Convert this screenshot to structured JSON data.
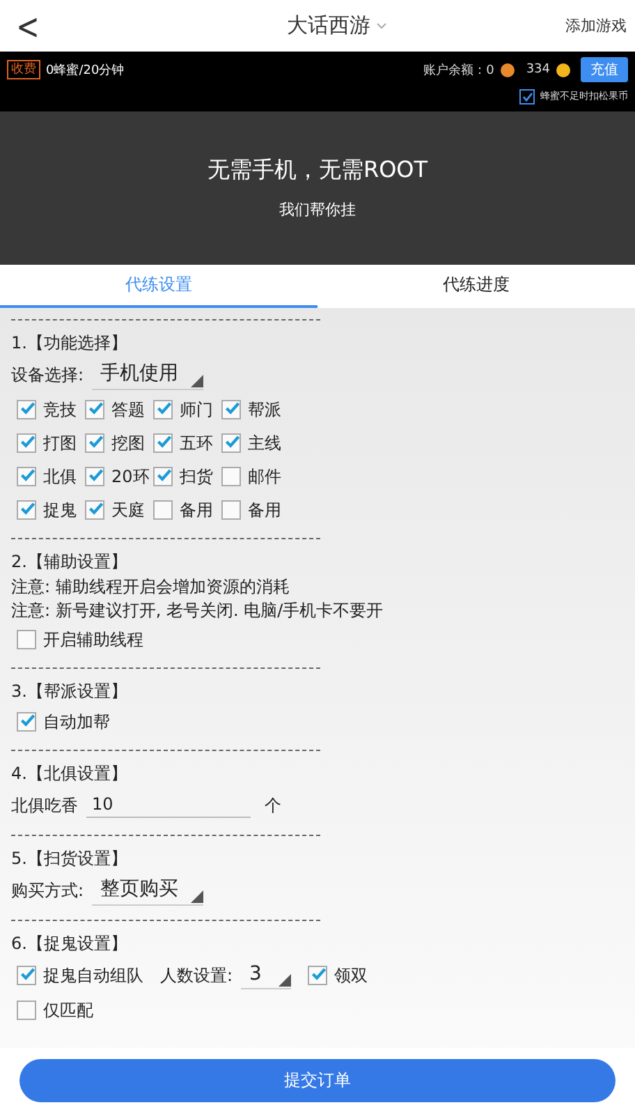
{
  "header": {
    "back": "<",
    "title": "大话西游",
    "action": "添加游戏"
  },
  "account": {
    "badge": "收费",
    "rate": "0蜂蜜/20分钟",
    "balance_label": "账户余额：0",
    "coins": "334",
    "recharge": "充值",
    "auto_deduct": {
      "label": "蜂蜜不足时扣松果币",
      "checked": true
    }
  },
  "banner": {
    "headline": "无需手机，无需ROOT",
    "subline": "我们帮你挂"
  },
  "tabs": [
    {
      "label": "代练设置",
      "selected": true
    },
    {
      "label": "代练进度",
      "selected": false
    }
  ],
  "sections": [
    {
      "title": "1.【功能选择】",
      "items": [
        {
          "kind": "select",
          "label": "设备选择:",
          "value": "手机使用"
        },
        {
          "kind": "grid",
          "options": [
            {
              "label": "竞技",
              "checked": true
            },
            {
              "label": "答题",
              "checked": true
            },
            {
              "label": "师门",
              "checked": true
            },
            {
              "label": "帮派",
              "checked": true
            },
            {
              "label": "打图",
              "checked": true
            },
            {
              "label": "挖图",
              "checked": true
            },
            {
              "label": "五环",
              "checked": true
            },
            {
              "label": "主线",
              "checked": true
            },
            {
              "label": "北俱",
              "checked": true
            },
            {
              "label": "20环",
              "checked": true
            },
            {
              "label": "扫货",
              "checked": true
            },
            {
              "label": "邮件",
              "checked": false
            },
            {
              "label": "捉鬼",
              "checked": true
            },
            {
              "label": "天庭",
              "checked": true
            },
            {
              "label": "备用",
              "checked": false
            },
            {
              "label": "备用",
              "checked": false
            }
          ]
        }
      ]
    },
    {
      "title": "2.【辅助设置】",
      "items": [
        {
          "kind": "note",
          "text": "注意: 辅助线程开启会增加资源的消耗"
        },
        {
          "kind": "note",
          "text": "注意: 新号建议打开, 老号关闭. 电脑/手机卡不要开"
        },
        {
          "kind": "checkbox",
          "label": "开启辅助线程",
          "checked": false
        }
      ]
    },
    {
      "title": "3.【帮派设置】",
      "items": [
        {
          "kind": "checkbox",
          "label": "自动加帮",
          "checked": true
        }
      ]
    },
    {
      "title": "4.【北俱设置】",
      "items": [
        {
          "kind": "field",
          "label": "北俱吃香",
          "value": "10",
          "unit": "个"
        }
      ]
    },
    {
      "title": "5.【扫货设置】",
      "items": [
        {
          "kind": "select",
          "label": "购买方式:",
          "value": "整页购买"
        }
      ]
    },
    {
      "title": "6.【捉鬼设置】",
      "items": [
        {
          "kind": "inline",
          "parts": [
            {
              "kind": "checkbox",
              "label": "捉鬼自动组队",
              "checked": true
            },
            {
              "kind": "select",
              "label": "人数设置:",
              "value": "3"
            },
            {
              "kind": "checkbox",
              "label": "领双",
              "checked": true
            }
          ]
        },
        {
          "kind": "checkbox",
          "label": "仅匹配",
          "checked": false
        }
      ]
    }
  ],
  "submit": "提交订单"
}
